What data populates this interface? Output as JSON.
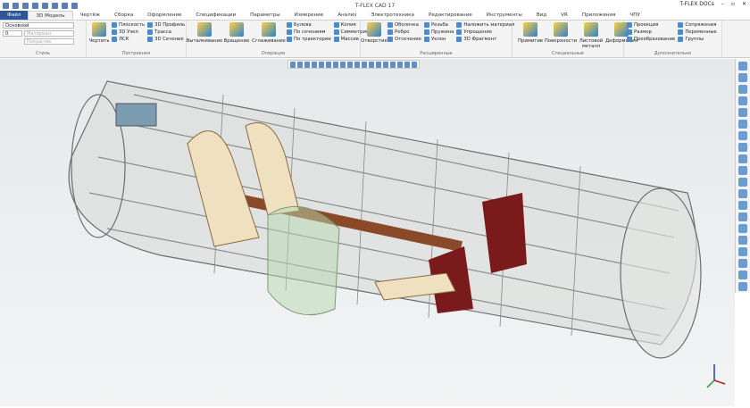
{
  "app": {
    "title": "T-FLEX CAD 17",
    "docs": "T-FLEX DOCs"
  },
  "tabs": [
    "Файл",
    "3D Модель",
    "Чертёж",
    "Сборка",
    "Оформление",
    "Спецификации",
    "Параметры",
    "Измерение",
    "Анализ",
    "Электротехника",
    "Редактирование",
    "Инструменты",
    "Вид",
    "VR",
    "Приложения",
    "ЧПУ"
  ],
  "ribbon": {
    "style": {
      "label": "Стиль",
      "layer": "Основной",
      "level": "0",
      "material": "Материал",
      "coating": "Покрытие"
    },
    "construct": {
      "label": "Построения",
      "draw": "Чертить",
      "items": [
        "Плоскость",
        "3D Узел",
        "ЛСК",
        "3D Профиль",
        "Трасса",
        "3D Сечение"
      ]
    },
    "operations": {
      "label": "Операции",
      "big": [
        "Выталкивание",
        "Вращение",
        "Сглаживание"
      ],
      "items": [
        "Булева",
        "По сечениям",
        "По траектории",
        "Копия",
        "Симметрия",
        "Массив"
      ]
    },
    "extended": {
      "label": "Расширенные",
      "big": "Отверстие",
      "items": [
        "Оболочка",
        "Ребро",
        "Отсечение",
        "Резьба",
        "Пружина",
        "Уклон",
        "Наложить материал",
        "Упрощение",
        "3D Фрагмент"
      ]
    },
    "special": {
      "label": "Специальные",
      "big": [
        "Примитив",
        "Поверхности",
        "Листовой металл",
        "Деформация"
      ]
    },
    "extra": {
      "label": "Дополнительно",
      "items": [
        "Проекция",
        "Размер",
        "Преобразование",
        "Сопряжения",
        "Переменные",
        "Группы"
      ]
    }
  },
  "colors": {
    "file_tab": "#2b5797",
    "viewport": "#eceef0"
  }
}
